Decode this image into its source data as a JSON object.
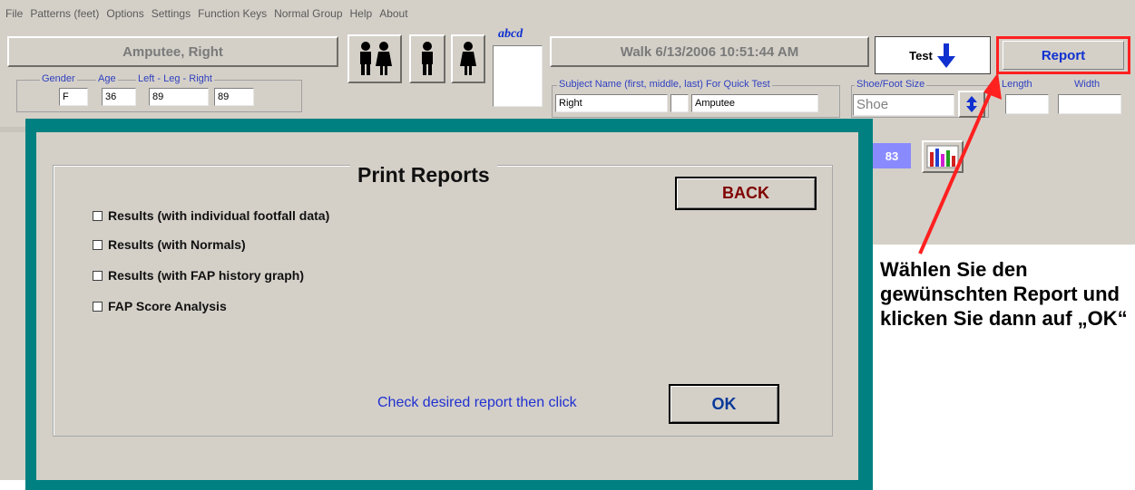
{
  "menu": [
    "File",
    "Patterns (feet)",
    "Options",
    "Settings",
    "Function Keys",
    "Normal Group",
    "Help",
    "About"
  ],
  "header": {
    "patient_button": "Amputee, Right",
    "abcd_label": "abcd",
    "walk_label": "Walk  6/13/2006 10:51:44 AM",
    "test_label": "Test",
    "report_label": "Report"
  },
  "demographics": {
    "gender_label": "Gender",
    "age_label": "Age",
    "leg_label": "Left - Leg - Right",
    "gender": "F",
    "age": "36",
    "left_leg": "89",
    "right_leg": "89"
  },
  "subject": {
    "label": "Subject Name (first, middle, last) For Quick Test",
    "first": "Right",
    "middle": "",
    "last": "Amputee"
  },
  "shoe": {
    "label": "Shoe/Foot Size",
    "value": "Shoe",
    "length_label": "Length",
    "width_label": "Width"
  },
  "background": {
    "badge": "83"
  },
  "dialog": {
    "title": "Print Reports",
    "back": "BACK",
    "options": [
      "Results (with individual footfall data)",
      "Results (with Normals)",
      "Results (with FAP history graph)",
      "FAP Score Analysis"
    ],
    "instruction": "Check desired report then click",
    "ok": "OK"
  },
  "annotation": {
    "text": "Wählen Sie den gewünschten Report und klicken Sie dann auf „OK“"
  },
  "colors": {
    "dialog_frame": "#008080",
    "arrow": "#ff2020",
    "accent_blue": "#1030d0"
  }
}
